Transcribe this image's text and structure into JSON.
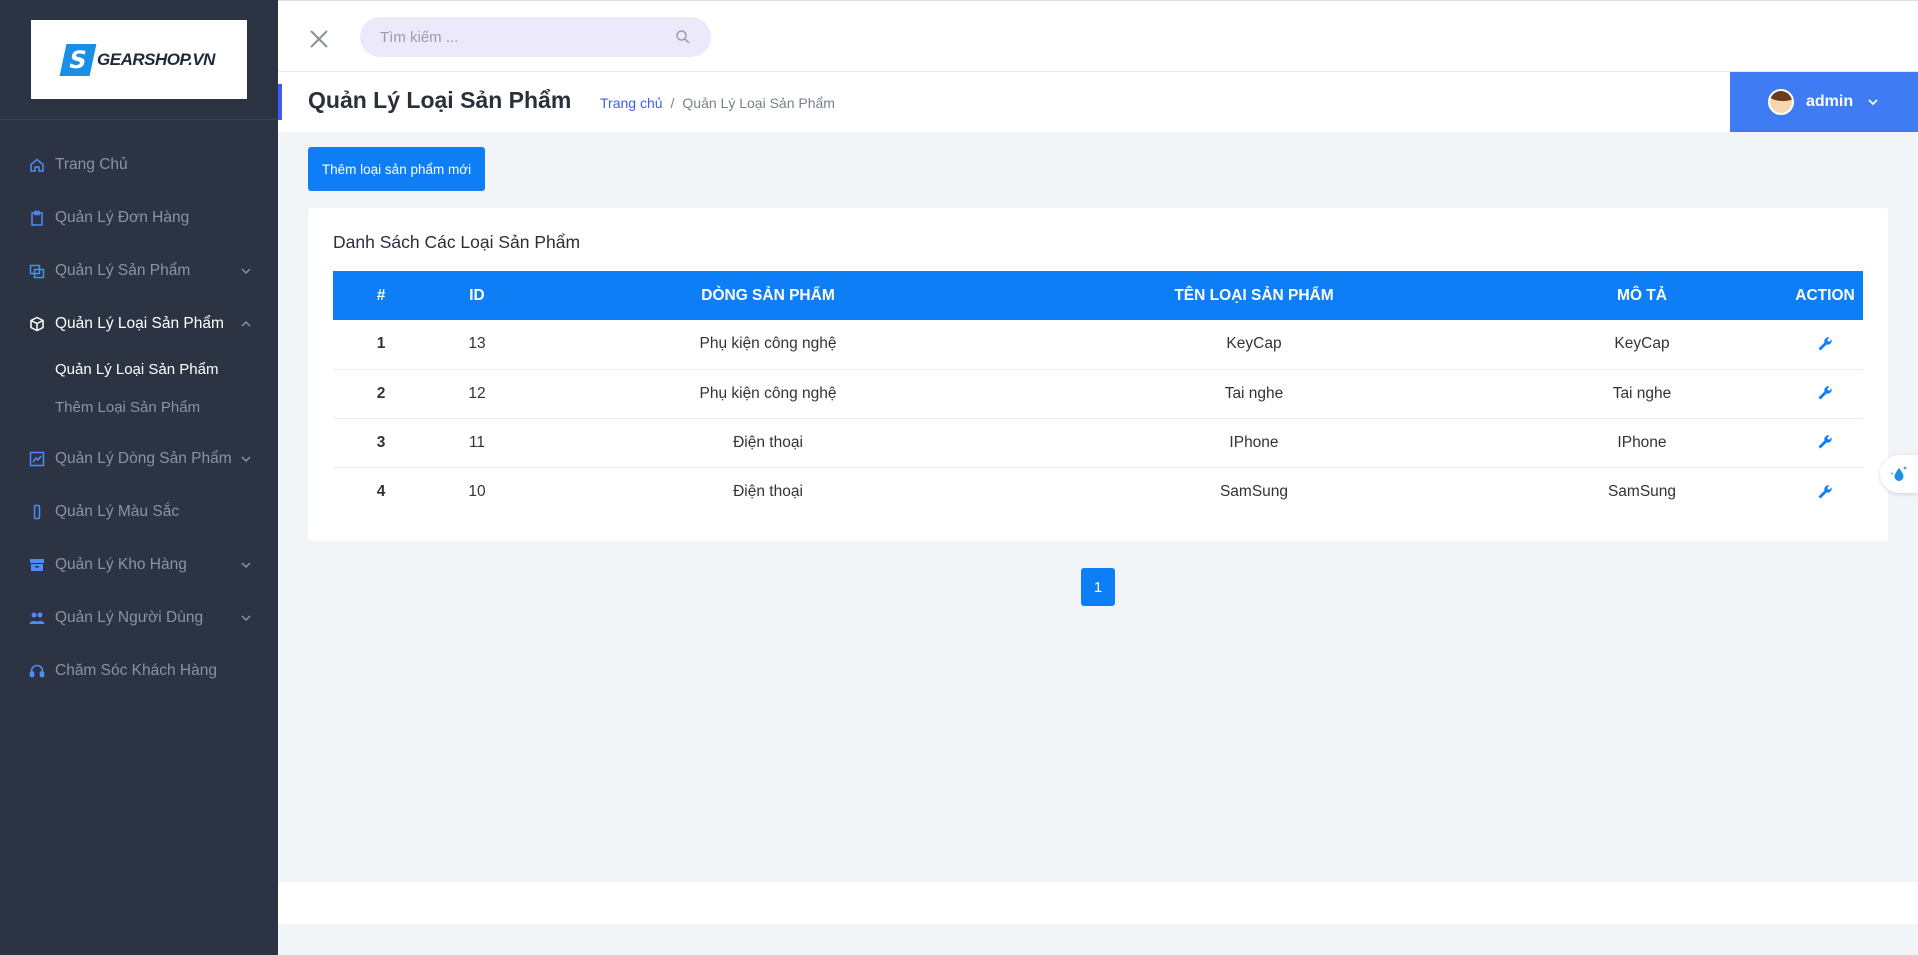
{
  "app": {
    "logo_text": "GEARSHOP.VN",
    "logo_mark": "S"
  },
  "sidebar": {
    "items": [
      {
        "label": "Trang Chủ",
        "icon": "home-icon"
      },
      {
        "label": "Quản Lý Đơn Hàng",
        "icon": "clipboard-icon"
      },
      {
        "label": "Quản Lý Sản Phẩm",
        "icon": "products-icon"
      },
      {
        "label": "Quản Lý Loại Sản Phẩm",
        "icon": "box-icon"
      },
      {
        "label": "Quản Lý Dòng Sản Phẩm",
        "icon": "chart-icon"
      },
      {
        "label": "Quản Lý Màu Sắc",
        "icon": "phone-icon"
      },
      {
        "label": "Quản Lý Kho Hàng",
        "icon": "archive-icon"
      },
      {
        "label": "Quản Lý Người Dùng",
        "icon": "users-icon"
      },
      {
        "label": "Chăm Sóc Khách Hàng",
        "icon": "headset-icon"
      }
    ],
    "submenu": [
      {
        "label": "Quản Lý Loại Sản Phẩm"
      },
      {
        "label": "Thêm Loại Sản Phẩm"
      }
    ]
  },
  "search": {
    "placeholder": "Tìm kiếm ..."
  },
  "header": {
    "title": "Quản Lý Loại Sản Phẩm",
    "breadcrumb_home": "Trang chủ",
    "breadcrumb_sep": "/",
    "breadcrumb_current": "Quản Lý Loại Sản Phẩm",
    "user_name": "admin"
  },
  "main": {
    "add_button": "Thêm loại sản phẩm mới",
    "card_title": "Danh Sách Các Loại Sản Phẩm",
    "columns": [
      "#",
      "ID",
      "DÒNG SẢN PHẨM",
      "TÊN LOẠI SẢN PHẨM",
      "MÔ TẢ",
      "ACTION"
    ],
    "rows": [
      {
        "num": "1",
        "id": "13",
        "line": "Phụ kiện công nghệ",
        "name": "KeyCap",
        "desc": "KeyCap"
      },
      {
        "num": "2",
        "id": "12",
        "line": "Phụ kiện công nghệ",
        "name": "Tai nghe",
        "desc": "Tai nghe"
      },
      {
        "num": "3",
        "id": "11",
        "line": "Điện thoại",
        "name": "IPhone",
        "desc": "IPhone"
      },
      {
        "num": "4",
        "id": "10",
        "line": "Điện thoại",
        "name": "SamSung",
        "desc": "SamSung"
      }
    ],
    "page": "1"
  },
  "colors": {
    "sidebar_bg": "#2c3342",
    "primary": "#0d7ef5",
    "user_box": "#3f7cf4",
    "accent": "#3d5cf5"
  }
}
